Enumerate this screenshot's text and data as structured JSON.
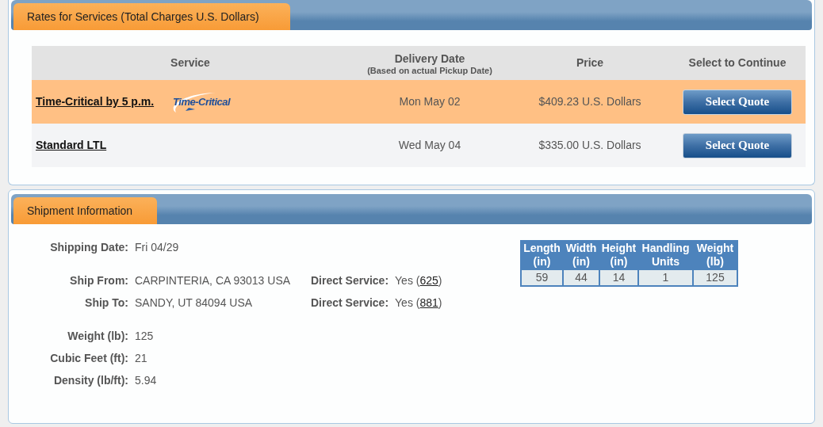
{
  "rates_panel": {
    "title": "Rates for Services (Total Charges U.S. Dollars)",
    "columns": [
      {
        "label": "Service"
      },
      {
        "label": "Delivery Date",
        "sublabel": "(Based on actual Pickup Date)"
      },
      {
        "label": "Price"
      },
      {
        "label": "Select to Continue"
      }
    ],
    "rows": [
      {
        "service": "Time-Critical by 5 p.m.",
        "logo_text": "Time-Critical",
        "delivery_date": "Mon May 02",
        "price": "$409.23 U.S. Dollars",
        "button": "Select Quote",
        "selected": true
      },
      {
        "service": "Standard LTL",
        "delivery_date": "Wed May 04",
        "price": "$335.00 U.S. Dollars",
        "button": "Select Quote",
        "selected": false
      }
    ]
  },
  "shipment_panel": {
    "title": "Shipment Information",
    "groups": [
      [
        {
          "label": "Shipping Date:",
          "value": "Fri 04/29"
        }
      ],
      [
        {
          "label": "Ship From:",
          "value": "CARPINTERIA, CA 93013 USA",
          "extra": {
            "label": "Direct Service:",
            "prefix": "Yes (",
            "link": "625",
            "suffix": ")"
          }
        },
        {
          "label": "Ship To:",
          "value": "SANDY, UT 84094 USA",
          "extra": {
            "label": "Direct Service:",
            "prefix": "Yes (",
            "link": "881",
            "suffix": ")"
          }
        }
      ],
      [
        {
          "label": "Weight (lb):",
          "value": "125"
        },
        {
          "label": "Cubic Feet (ft):",
          "value": "21"
        },
        {
          "label": "Density (lb/ft):",
          "value": "5.94"
        }
      ]
    ],
    "dimensions": {
      "columns": [
        [
          "Length",
          "(in)"
        ],
        [
          "Width",
          "(in)"
        ],
        [
          "Height",
          "(in)"
        ],
        [
          "Handling",
          "Units"
        ],
        [
          "Weight",
          "(lb)"
        ]
      ],
      "values": [
        "59",
        "44",
        "14",
        "1",
        "125"
      ]
    }
  }
}
